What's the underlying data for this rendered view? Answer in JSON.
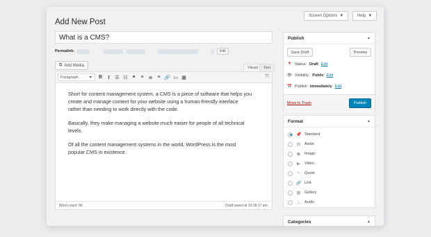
{
  "header": {
    "screen_options_label": "Screen Options",
    "help_label": "Help",
    "page_title": "Add New Post"
  },
  "post": {
    "title": "What is a CMS?",
    "permalink_label": "Permalink:",
    "edit_slug_label": "Edit"
  },
  "editor": {
    "add_media_label": "Add Media",
    "tab_visual": "Visual",
    "tab_text": "Text",
    "format_select": "Paragraph",
    "toolbar_icons": [
      "bold-icon",
      "italic-icon",
      "bullet-list-icon",
      "numbered-list-icon",
      "blockquote-icon",
      "align-left-icon",
      "align-center-icon",
      "align-right-icon",
      "insert-link-icon",
      "read-more-icon",
      "toolbar-toggle-icon",
      "fullscreen-icon"
    ],
    "paragraphs": [
      "Short for content management system, a CMS is a piece of software that helps you create and manage content for your website using a human-friendly interface rather than needing to work directly with the code.",
      "Basically, they make managing a website much easier for people of all technical levels.",
      "Of all the content management systems in the world, WordPress is the most popular CMS in existence."
    ],
    "word_count": "Word count: 66",
    "draft_saved": "Draft saved at 10:18:17 am."
  },
  "publish_box": {
    "title": "Publish",
    "save_draft_label": "Save Draft",
    "preview_label": "Preview",
    "status_label": "Status:",
    "status_value": "Draft",
    "visibility_label": "Visibility:",
    "visibility_value": "Public",
    "publish_label": "Publish",
    "publish_value": "immediately",
    "edit_label": "Edit",
    "trash_label": "Move to Trash",
    "publish_button_label": "Publish"
  },
  "format_box": {
    "title": "Format",
    "options": [
      {
        "label": "Standard",
        "icon": "pin-icon",
        "checked": true
      },
      {
        "label": "Aside",
        "icon": "aside-icon",
        "checked": false
      },
      {
        "label": "Image",
        "icon": "image-icon",
        "checked": false
      },
      {
        "label": "Video",
        "icon": "video-icon",
        "checked": false
      },
      {
        "label": "Quote",
        "icon": "quote-icon",
        "checked": false
      },
      {
        "label": "Link",
        "icon": "link-icon",
        "checked": false
      },
      {
        "label": "Gallery",
        "icon": "gallery-icon",
        "checked": false
      },
      {
        "label": "Audio",
        "icon": "audio-icon",
        "checked": false
      }
    ]
  },
  "categories_box": {
    "title": "Categories"
  },
  "colors": {
    "accent": "#0085ba",
    "link": "#0073aa",
    "trash": "#a00"
  }
}
